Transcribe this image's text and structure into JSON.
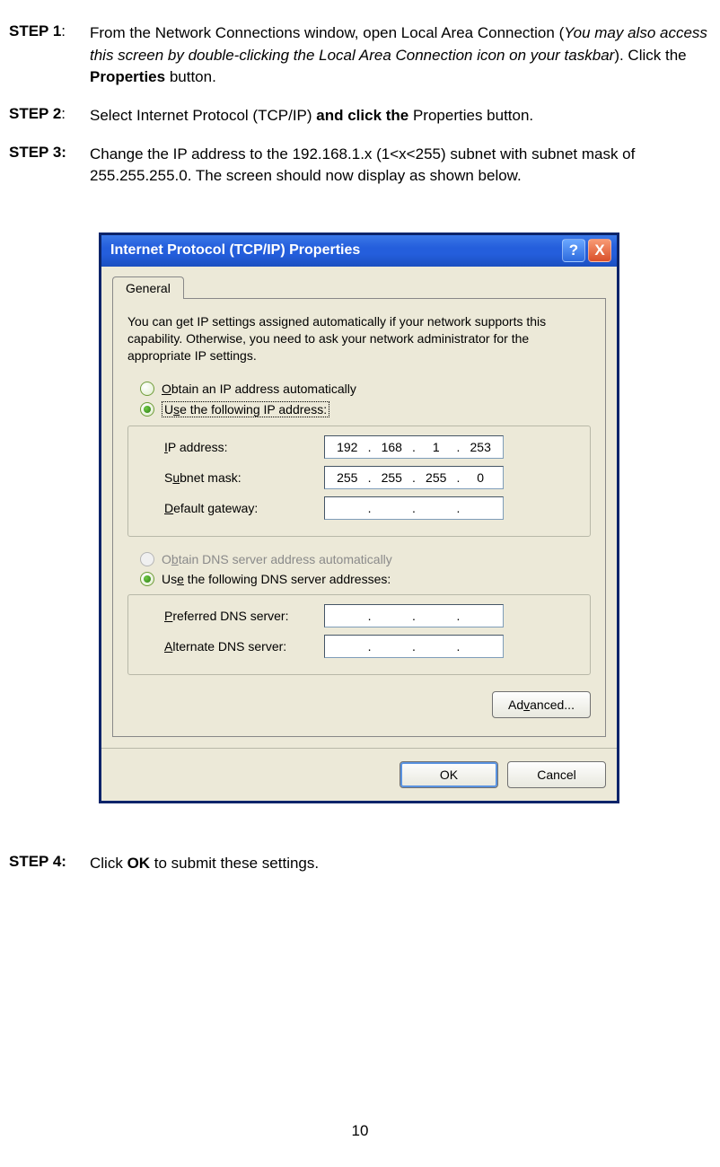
{
  "steps": {
    "s1": {
      "label": "STEP 1",
      "colon": ":",
      "text_a": "From the Network Connections window, open Local Area Connection (",
      "text_italic": "You may also access this screen by double-clicking the Local Area Connection icon on your taskbar",
      "text_b": "). Click the ",
      "text_bold": "Properties",
      "text_c": " button."
    },
    "s2": {
      "label": "STEP 2",
      "colon": ":",
      "text_a": "Select Internet Protocol (TCP/IP) ",
      "text_bold": "and click the ",
      "text_b": "Properties button."
    },
    "s3": {
      "label": "STEP 3:",
      "text": "Change the IP address to the 192.168.1.x (1<x<255) subnet with subnet mask of 255.255.255.0. The screen should now display as shown below."
    },
    "s4": {
      "label": "STEP 4:",
      "text_a": "Click ",
      "text_bold": "OK",
      "text_b": " to submit these settings."
    }
  },
  "dialog": {
    "title": "Internet Protocol (TCP/IP) Properties",
    "help_symbol": "?",
    "close_symbol": "X",
    "tab": "General",
    "desc": "You can get IP settings assigned automatically if your network supports this capability. Otherwise, you need to ask your network administrator for the appropriate IP settings.",
    "radio_auto_ip": "Obtain an IP address automatically",
    "radio_use_ip": "Use the following IP address:",
    "ip_label": "IP address:",
    "subnet_label": "Subnet mask:",
    "gateway_label": "Default gateway:",
    "radio_auto_dns": "Obtain DNS server address automatically",
    "radio_use_dns": "Use the following DNS server addresses:",
    "pref_dns_label": "Preferred DNS server:",
    "alt_dns_label": "Alternate DNS server:",
    "advanced": "Advanced...",
    "ok": "OK",
    "cancel": "Cancel",
    "ip": {
      "a": "192",
      "b": "168",
      "c": "1",
      "d": "253"
    },
    "mask": {
      "a": "255",
      "b": "255",
      "c": "255",
      "d": "0"
    }
  },
  "page_number": "10"
}
